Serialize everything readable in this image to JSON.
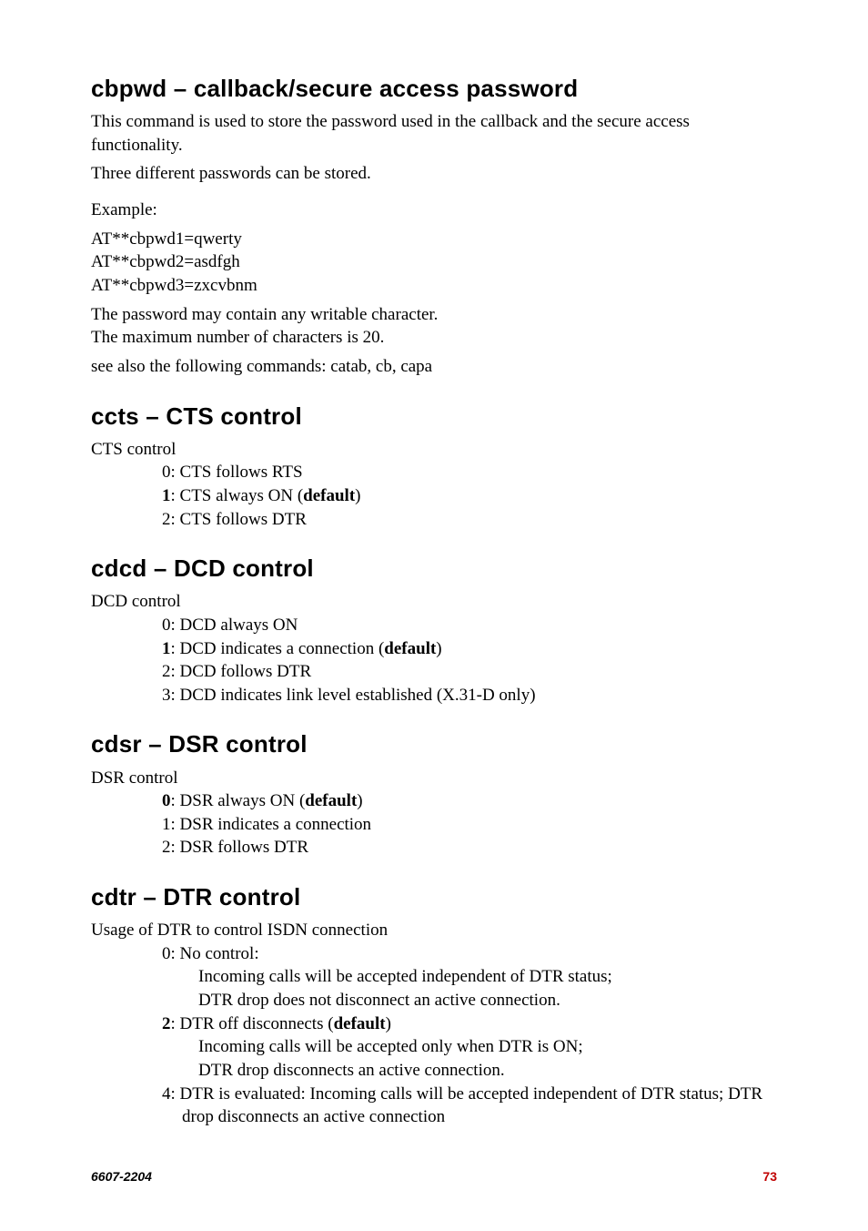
{
  "s1": {
    "heading": "cbpwd – callback/secure access password",
    "p1": "This command is used to store the password used in the callback and the secure access functionality.",
    "p2": "Three different passwords can be stored.",
    "exlabel": "Example:",
    "ex1": "AT**cbpwd1=qwerty",
    "ex2": "AT**cbpwd2=asdfgh",
    "ex3": "AT**cbpwd3=zxcvbnm",
    "p3": "The password may contain any writable character.",
    "p4": "The maximum number of characters is 20.",
    "p5": "see also the following commands: catab, cb, capa"
  },
  "s2": {
    "heading": "ccts – CTS control",
    "lead": "CTS control",
    "i0": "0: CTS follows RTS",
    "i1a": "1",
    "i1b": ": CTS always ON (",
    "i1c": "default",
    "i1d": ")",
    "i2": "2: CTS follows DTR"
  },
  "s3": {
    "heading": "cdcd – DCD control",
    "lead": "DCD control",
    "i0": "0: DCD always ON",
    "i1a": "1",
    "i1b": ": DCD indicates a connection (",
    "i1c": "default",
    "i1d": ")",
    "i2": "2: DCD follows DTR",
    "i3": "3: DCD indicates link level established (X.31-D only)"
  },
  "s4": {
    "heading": "cdsr – DSR control",
    "lead": "DSR control",
    "i0a": "0",
    "i0b": ": DSR always ON (",
    "i0c": "default",
    "i0d": ")",
    "i1": "1: DSR indicates a connection",
    "i2": "2: DSR follows DTR"
  },
  "s5": {
    "heading": "cdtr – DTR control",
    "lead": "Usage of DTR to control ISDN connection",
    "i0": "0: No control:",
    "i0s1": "Incoming calls will be accepted independent of DTR status;",
    "i0s2": "DTR drop does not disconnect an active connection.",
    "i2a": "2",
    "i2b": ": DTR off disconnects (",
    "i2c": "default",
    "i2d": ")",
    "i2s1": "Incoming calls will be accepted only when DTR is ON;",
    "i2s2": "DTR drop disconnects an active connection.",
    "i4": "4: DTR is evaluated: Incoming calls will be accepted independent of DTR status; DTR drop disconnects an active connection"
  },
  "footer": {
    "left": "6607-2204",
    "right": "73"
  }
}
